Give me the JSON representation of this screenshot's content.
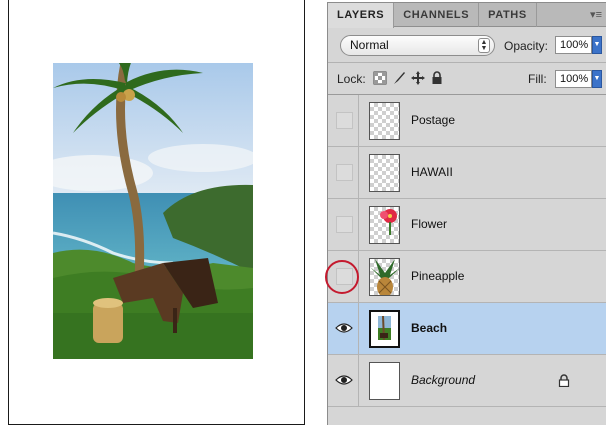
{
  "tabs": [
    {
      "label": "LAYERS",
      "active": true
    },
    {
      "label": "CHANNELS",
      "active": false
    },
    {
      "label": "PATHS",
      "active": false
    }
  ],
  "panel_menu_icon": "panel-menu-icon",
  "blend_mode": "Normal",
  "opacity": {
    "label": "Opacity:",
    "value": "100%"
  },
  "lock": {
    "label": "Lock:",
    "icons": [
      "lock-transparency-icon",
      "lock-paint-icon",
      "lock-position-icon",
      "lock-all-icon"
    ]
  },
  "fill": {
    "label": "Fill:",
    "value": "100%"
  },
  "layers": [
    {
      "name": "Postage",
      "visible": false,
      "selected": false,
      "thumb": "transparent"
    },
    {
      "name": "HAWAII",
      "visible": false,
      "selected": false,
      "thumb": "transparent"
    },
    {
      "name": "Flower",
      "visible": false,
      "selected": false,
      "thumb": "flower"
    },
    {
      "name": "Pineapple",
      "visible": false,
      "selected": false,
      "thumb": "pineapple",
      "highlighted": true
    },
    {
      "name": "Beach",
      "visible": true,
      "selected": true,
      "thumb": "beach"
    },
    {
      "name": "Background",
      "visible": true,
      "selected": false,
      "thumb": "white",
      "locked": true
    }
  ],
  "colors": {
    "selection": "#b7d2ef",
    "highlight_circle": "#c41a2e",
    "dropdown_accent": "#3c73c9"
  }
}
